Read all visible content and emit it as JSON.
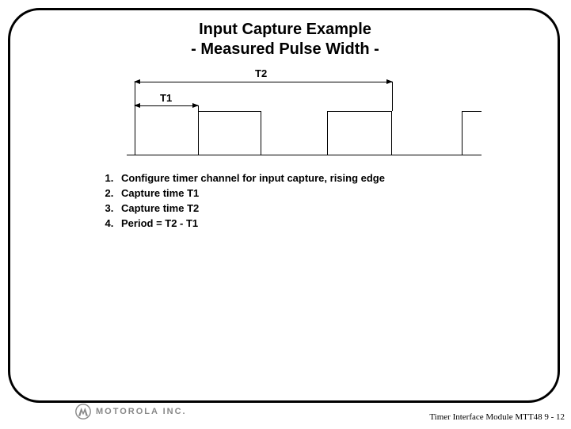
{
  "title": {
    "line1": "Input Capture Example",
    "line2": "- Measured Pulse Width -"
  },
  "labels": {
    "t1": "T1",
    "t2": "T2"
  },
  "steps": [
    "Configure timer channel for input capture, rising edge",
    "Capture time T1",
    "Capture time T2",
    "Period = T2 - T1"
  ],
  "footer": {
    "brand_text": "MOTOROLA INC.",
    "page_label": "Timer Interface Module MTT48  9 - 12"
  }
}
